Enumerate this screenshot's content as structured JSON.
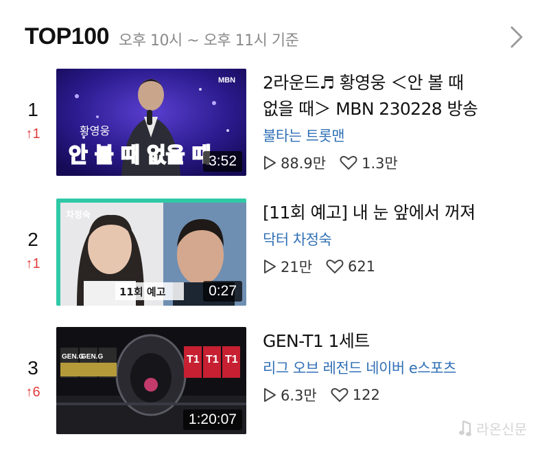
{
  "header": {
    "title": "TOP100",
    "subtitle": "오후 10시 ~ 오후 11시 기준"
  },
  "items": [
    {
      "rank": "1",
      "change": "↑1",
      "title_line1": "2라운드♬ 황영웅 ＜안 볼 때",
      "title_line2": "없을 때＞ MBN 230228 방송",
      "channel": "불타는 트롯맨",
      "views": "88.9만",
      "likes": "1.3만",
      "duration": "3:52",
      "thumb_caption": "안 볼 때 없을 때",
      "thumb_name": "황영웅",
      "thumb_logo": "MBN"
    },
    {
      "rank": "2",
      "change": "↑1",
      "title_line1": "[11회 예고] 내 눈 앞에서 꺼져",
      "channel": "닥터 차정숙",
      "views": "21만",
      "likes": "621",
      "duration": "0:27",
      "thumb_badge": "11회 예고",
      "thumb_logo": "차정숙"
    },
    {
      "rank": "3",
      "change": "↑6",
      "title_line1": "GEN-T1 1세트",
      "channel": "리그 오브 레전드 네이버 e스포츠",
      "views": "6.3만",
      "likes": "122",
      "duration": "1:20:07",
      "thumb_left_team": "GEN.G",
      "thumb_right_team": "T1"
    }
  ],
  "watermark": "라온신문",
  "colors": {
    "rank_up": "#e23b3b",
    "channel": "#2f6fb5",
    "subtitle": "#8a8a8a"
  },
  "icons": {
    "header_more": "chevron-right-icon",
    "views": "play-outline-icon",
    "likes": "heart-outline-icon",
    "watermark": "music-note-icon"
  }
}
